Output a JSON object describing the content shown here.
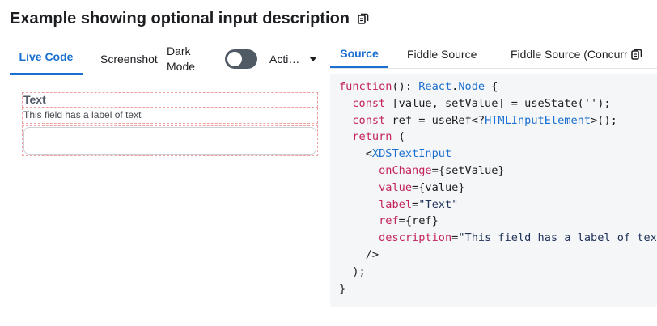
{
  "header": {
    "title": "Example showing optional input description",
    "copy_icon": "copy-icon"
  },
  "left_tabs": {
    "live_code": "Live Code",
    "screenshot": "Screenshot",
    "dark_mode": "Dark Mode",
    "dark_mode_on": false,
    "actions": "Acti…"
  },
  "preview": {
    "label": "Text",
    "description": "This field has a label of text",
    "input_value": ""
  },
  "right_tabs": {
    "source": "Source",
    "fiddle": "Fiddle Source",
    "fiddle_concurrent": "Fiddle Source (Concurrent)",
    "copy_icon": "copy-icon"
  },
  "code": {
    "lines": [
      "function(): React.Node {",
      "  const [value, setValue] = useState('');",
      "  const ref = useRef<?HTMLInputElement>();",
      "  return (",
      "    <XDSTextInput",
      "      onChange={setValue}",
      "      value={value}",
      "      label=\"Text\"",
      "      ref={ref}",
      "      description=\"This field has a label of text\"",
      "    />",
      "  );",
      "}"
    ]
  },
  "colors": {
    "accent": "#1a6fd0",
    "toggle_off": "#505a64",
    "code_bg": "#f5f6f7",
    "keyword": "#c4245f"
  }
}
